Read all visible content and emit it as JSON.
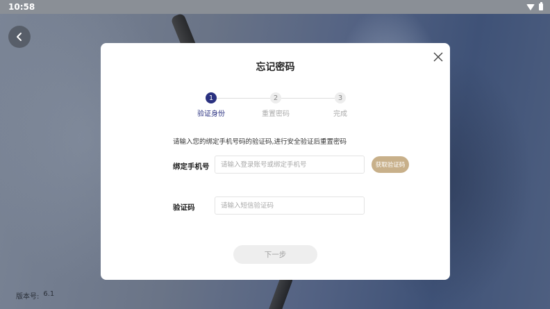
{
  "status_bar": {
    "time": "10:58",
    "icons": [
      "wifi-icon",
      "battery-icon"
    ]
  },
  "back_button": {
    "icon": "chevron-left-icon"
  },
  "version": {
    "label": "版本号:",
    "value": "6.1"
  },
  "dialog": {
    "title": "忘记密码",
    "close_icon": "close-icon",
    "steps": [
      {
        "number": "1",
        "label": "验证身份",
        "active": true
      },
      {
        "number": "2",
        "label": "重置密码",
        "active": false
      },
      {
        "number": "3",
        "label": "完成",
        "active": false
      }
    ],
    "instruction": "请输入您的绑定手机号码的验证码,进行安全验证后重置密码",
    "phone_field": {
      "label": "绑定手机号",
      "value": "",
      "placeholder": "请输入登录账号或绑定手机号"
    },
    "get_code_button": "获取验证码",
    "code_field": {
      "label": "验证码",
      "value": "",
      "placeholder": "请输入短信验证码"
    },
    "next_button": "下一步"
  },
  "colors": {
    "accent": "#2a3180",
    "code_button": "#c8b08a",
    "disabled_button": "#eeeeee"
  }
}
